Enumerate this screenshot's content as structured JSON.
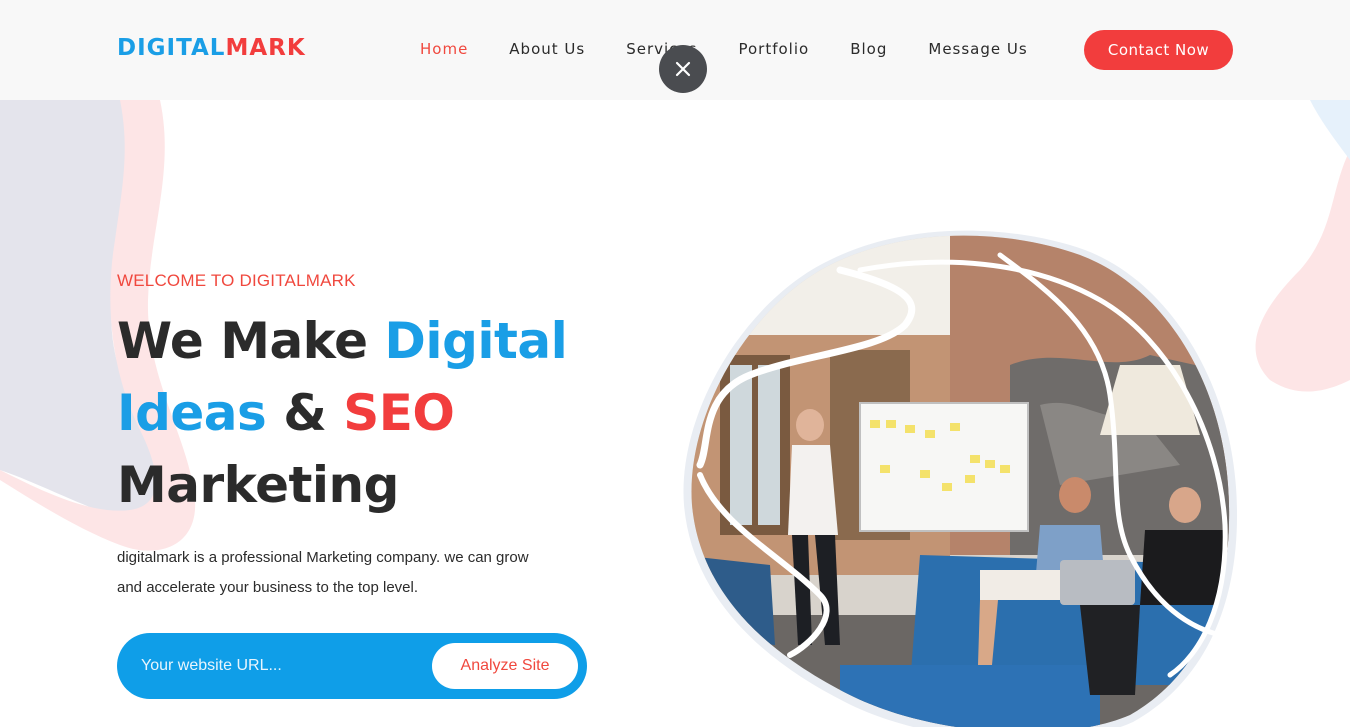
{
  "header": {
    "logo": {
      "part1": "DIGITAL",
      "part2": "MARK"
    },
    "nav": [
      {
        "label": "Home",
        "active": true
      },
      {
        "label": "About Us",
        "active": false
      },
      {
        "label": "Services",
        "active": false
      },
      {
        "label": "Portfolio",
        "active": false
      },
      {
        "label": "Blog",
        "active": false
      },
      {
        "label": "Message Us",
        "active": false
      }
    ],
    "contact_label": "Contact Now"
  },
  "overlay": {
    "close_icon": "close-icon"
  },
  "hero": {
    "eyebrow": "WELCOME TO DIGITALMARK",
    "headline": {
      "line1_dark": "We Make ",
      "line1_blue": "Digital",
      "line2_blue": "Ideas",
      "line2_dark": " & ",
      "line2_red": "SEO",
      "line3_dark": "Marketing"
    },
    "description_line1": "digitalmark is a professional Marketing company. we can grow",
    "description_line2": "and accelerate your business to the top level.",
    "url_input": {
      "value": "",
      "placeholder": "Your website URL..."
    },
    "analyze_label": "Analyze Site"
  },
  "colors": {
    "brand_blue": "#1a9ee6",
    "brand_red": "#f23d3d",
    "text_dark": "#2b2b2b",
    "header_bg": "#f8f8f8"
  }
}
